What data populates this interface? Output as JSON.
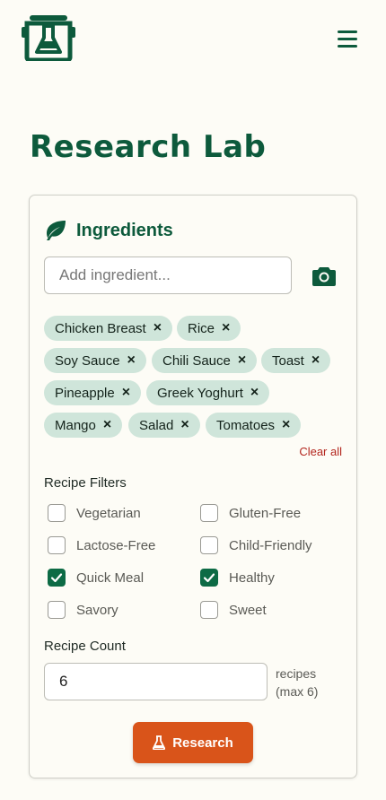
{
  "page": {
    "title": "Research Lab"
  },
  "header": {
    "logo_icon": "pot-flask-logo-icon",
    "menu_icon": "hamburger-menu-icon"
  },
  "ingredients": {
    "title": "Ingredients",
    "icon": "leaf-icon",
    "input_placeholder": "Add ingredient...",
    "camera_icon": "camera-icon",
    "chips": [
      "Chicken Breast",
      "Rice",
      "Soy Sauce",
      "Chili Sauce",
      "Toast",
      "Pineapple",
      "Greek Yoghurt",
      "Mango",
      "Salad",
      "Tomatoes"
    ],
    "remove_symbol": "×",
    "clear_all": "Clear all"
  },
  "filters": {
    "label": "Recipe Filters",
    "items": [
      {
        "label": "Vegetarian",
        "checked": false
      },
      {
        "label": "Gluten-Free",
        "checked": false
      },
      {
        "label": "Lactose-Free",
        "checked": false
      },
      {
        "label": "Child-Friendly",
        "checked": false
      },
      {
        "label": "Quick Meal",
        "checked": true
      },
      {
        "label": "Healthy",
        "checked": true
      },
      {
        "label": "Savory",
        "checked": false
      },
      {
        "label": "Sweet",
        "checked": false
      }
    ]
  },
  "count": {
    "label": "Recipe Count",
    "value": "6",
    "suffix": "recipes (max 6)"
  },
  "research_button": {
    "label": "Research",
    "icon": "flask-icon"
  },
  "colors": {
    "primary": "#0d5a3c",
    "accent": "#d9541a",
    "chip": "#cfe5da",
    "danger": "#b3261e",
    "background": "#fdfcf6"
  }
}
